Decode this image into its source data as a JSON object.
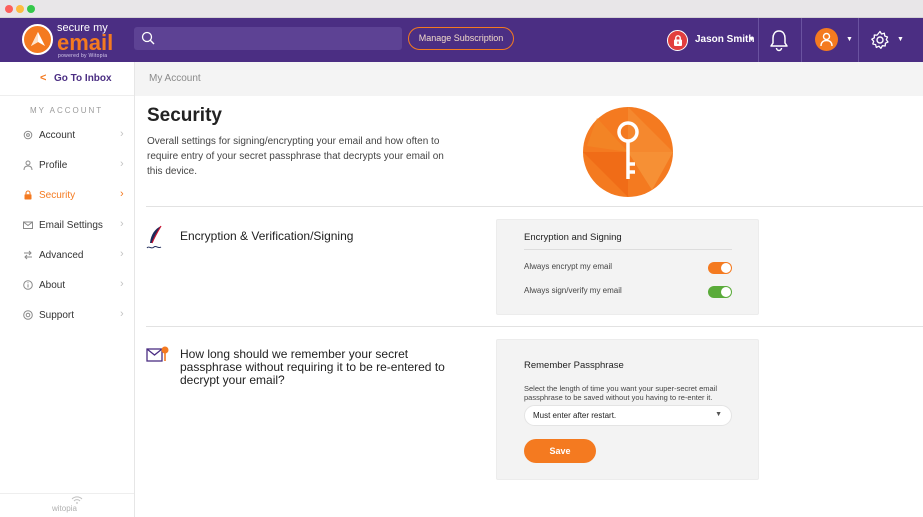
{
  "header": {
    "logo_top": "secure my",
    "logo_main": "email",
    "logo_sub": "powered by Witopia",
    "search_placeholder": "",
    "manage_subscription": "Manage Subscription",
    "user_name": "Jason Smith",
    "accent_color": "#f47a20",
    "bar_color": "#4b2e83"
  },
  "sidebar": {
    "go_to_inbox": "Go To Inbox",
    "section_label": "MY ACCOUNT",
    "items": [
      {
        "label": "Account",
        "icon": "gear-icon"
      },
      {
        "label": "Profile",
        "icon": "user-icon"
      },
      {
        "label": "Security",
        "icon": "lock-icon",
        "active": true
      },
      {
        "label": "Email Settings",
        "icon": "envelope-icon"
      },
      {
        "label": "Advanced",
        "icon": "arrows-icon"
      },
      {
        "label": "About",
        "icon": "info-icon"
      },
      {
        "label": "Support",
        "icon": "lifebuoy-icon"
      }
    ],
    "footer": "witopia"
  },
  "main": {
    "breadcrumb": "My Account",
    "title": "Security",
    "description": "Overall settings for signing/encrypting your email and how often to require entry of your secret passphrase that decrypts your email on this device.",
    "encryption_section": {
      "heading": "Encryption & Verification/Signing",
      "card_title": "Encryption and Signing",
      "toggles": [
        {
          "label": "Always encrypt my email",
          "on": true,
          "color": "#f47a20"
        },
        {
          "label": "Always sign/verify my email",
          "on": true,
          "color": "#5aab3a"
        }
      ]
    },
    "passphrase_section": {
      "heading": "How long should we remember your secret passphrase without requiring it to be re-entered to decrypt your email?",
      "card_title": "Remember Passphrase",
      "card_desc": "Select the length of time you want your super-secret email passphrase to be saved without you having to re-enter it.",
      "selected_option": "Must enter after restart.",
      "save_label": "Save"
    }
  }
}
